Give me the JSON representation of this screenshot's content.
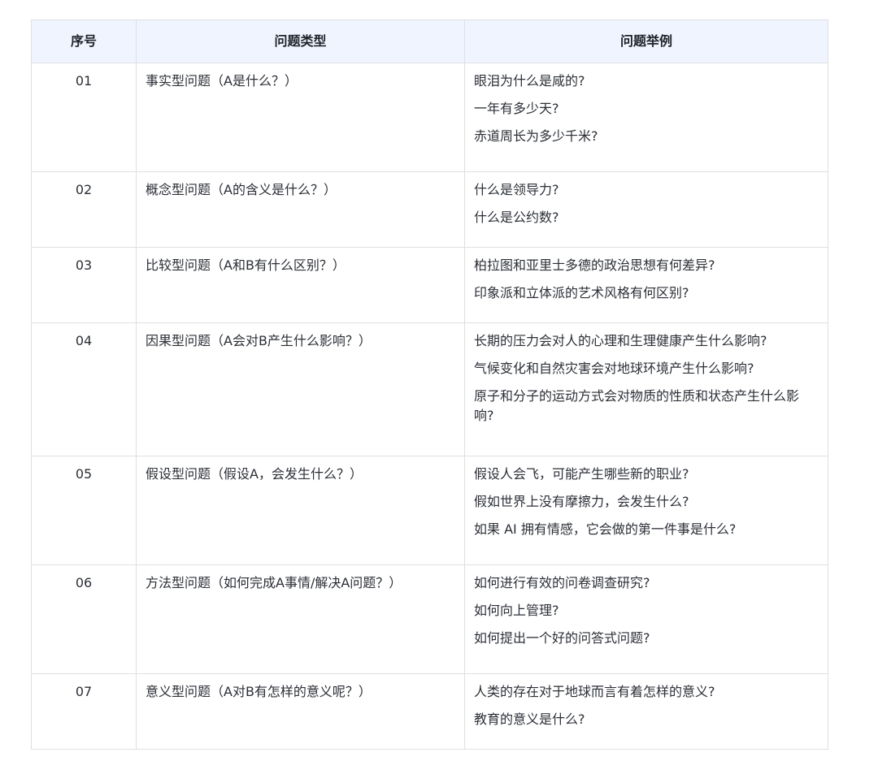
{
  "table": {
    "headers": [
      "序号",
      "问题类型",
      "问题举例"
    ],
    "rows": [
      {
        "no": "01",
        "type": "事实型问题（A是什么？）",
        "examples": [
          "眼泪为什么是咸的?",
          "一年有多少天?",
          "赤道周长为多少千米?"
        ]
      },
      {
        "no": "02",
        "type": "概念型问题（A的含义是什么？）",
        "examples": [
          "什么是领导力?",
          "什么是公约数?"
        ]
      },
      {
        "no": "03",
        "type": "比较型问题（A和B有什么区别？）",
        "examples": [
          "柏拉图和亚里士多德的政治思想有何差异?",
          "印象派和立体派的艺术风格有何区别?"
        ]
      },
      {
        "no": "04",
        "type": "因果型问题（A会对B产生什么影响？）",
        "examples": [
          "长期的压力会对人的心理和生理健康产生什么影响?",
          "气候变化和自然灾害会对地球环境产生什么影响?",
          "原子和分子的运动方式会对物质的性质和状态产生什么影响?"
        ]
      },
      {
        "no": "05",
        "type": "假设型问题（假设A，会发生什么？）",
        "examples": [
          "假设人会飞，可能产生哪些新的职业?",
          "假如世界上没有摩擦力，会发生什么?",
          "如果 AI 拥有情感，它会做的第一件事是什么?"
        ]
      },
      {
        "no": "06",
        "type": "方法型问题（如何完成A事情/解决A问题？）",
        "examples": [
          "如何进行有效的问卷调查研究?",
          "如何向上管理?",
          "如何提出一个好的问答式问题?"
        ]
      },
      {
        "no": "07",
        "type": "意义型问题（A对B有怎样的意义呢？）",
        "examples": [
          "人类的存在对于地球而言有着怎样的意义?",
          "教育的意义是什么?"
        ]
      }
    ]
  }
}
